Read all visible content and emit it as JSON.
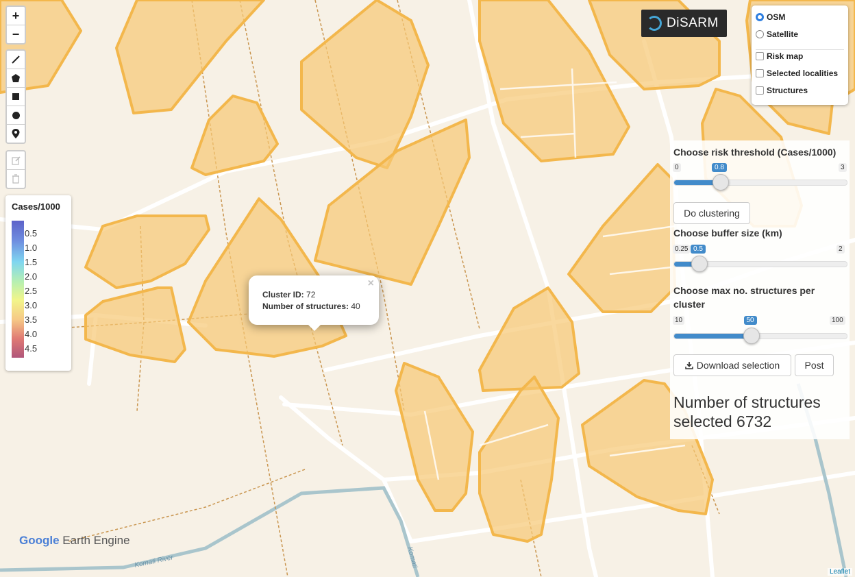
{
  "map": {
    "colors": {
      "background": "#f7f1e6",
      "road": "#ffffff",
      "river": "#a9c5cc",
      "boundary": "#c9954f",
      "cluster_fill": "#f6c873",
      "cluster_stroke": "#f3b74c"
    },
    "river_labels": [
      "Komati River",
      "Komati"
    ]
  },
  "controls": {
    "zoom_in": "+",
    "zoom_out": "−",
    "draw_icons": [
      "polyline-icon",
      "polygon-icon",
      "rectangle-icon",
      "circle-icon",
      "marker-icon"
    ],
    "edit_icons": [
      "edit-icon",
      "trash-icon"
    ]
  },
  "legend": {
    "title": "Cases/1000",
    "ticks": [
      "0.5",
      "1.0",
      "1.5",
      "2.0",
      "2.5",
      "3.0",
      "3.5",
      "4.0",
      "4.5"
    ]
  },
  "layers": {
    "base": [
      {
        "label": "OSM",
        "selected": true
      },
      {
        "label": "Satellite",
        "selected": false
      }
    ],
    "overlays": [
      {
        "label": "Risk map",
        "checked": false
      },
      {
        "label": "Selected localities",
        "checked": false
      },
      {
        "label": "Structures",
        "checked": false
      }
    ]
  },
  "logo": {
    "text": "DiSARM"
  },
  "panel": {
    "risk": {
      "label": "Choose risk threshold (Cases/1000)",
      "min": "0",
      "max": "3",
      "value": "0.8",
      "fraction": 0.267
    },
    "do_clustering": "Do clustering",
    "buffer": {
      "label": "Choose buffer size (km)",
      "min": "0.25",
      "max": "2",
      "value": "0.5",
      "fraction": 0.143
    },
    "max_struct": {
      "label": "Choose max no. structures per cluster",
      "min": "10",
      "max": "100",
      "value": "50",
      "fraction": 0.444
    },
    "download": "Download selection",
    "post": "Post",
    "count_text": "Number of structures selected 6732"
  },
  "popup": {
    "cluster_label": "Cluster ID:",
    "cluster_value": "72",
    "structures_label": "Number of structures:",
    "structures_value": "40",
    "close": "×"
  },
  "footer": {
    "gee_google": "Google",
    "gee_rest": " Earth Engine",
    "attribution": "Leaflet"
  }
}
